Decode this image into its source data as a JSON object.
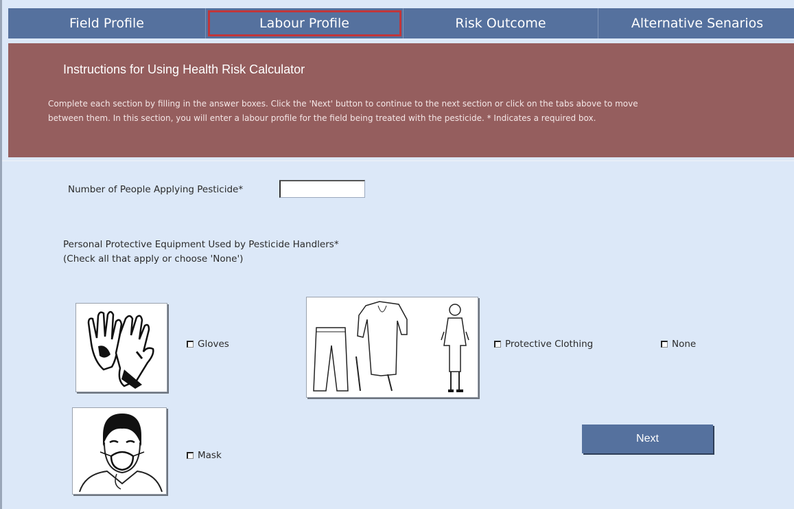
{
  "tabs": [
    {
      "label": "Field Profile"
    },
    {
      "label": "Labour Profile"
    },
    {
      "label": "Risk Outcome"
    },
    {
      "label": "Alternative Senarios"
    }
  ],
  "instructions": {
    "title": "Instructions for Using Health Risk Calculator",
    "line1": "Complete each section by filling in the answer boxes.  Click the 'Next' button to continue to the next section or click on the tabs above to move",
    "line2": "between them. In this section, you will enter a labour profile for the field being treated with the pesticide. * Indicates a required box."
  },
  "form": {
    "people_label": "Number of People Applying Pesticide*",
    "people_value": "",
    "ppe_label_line1": "Personal Protective Equipment Used by Pesticide Handlers*",
    "ppe_label_line2": "(Check all that apply or choose 'None')"
  },
  "options": {
    "gloves": "Gloves",
    "clothing": "Protective Clothing",
    "none": "None",
    "mask": "Mask"
  },
  "buttons": {
    "next": "Next"
  },
  "colors": {
    "tab_bg": "#55719e",
    "banner_bg": "#955e5e",
    "page_bg": "#dce8f8",
    "active_outline": "#c0363a"
  }
}
